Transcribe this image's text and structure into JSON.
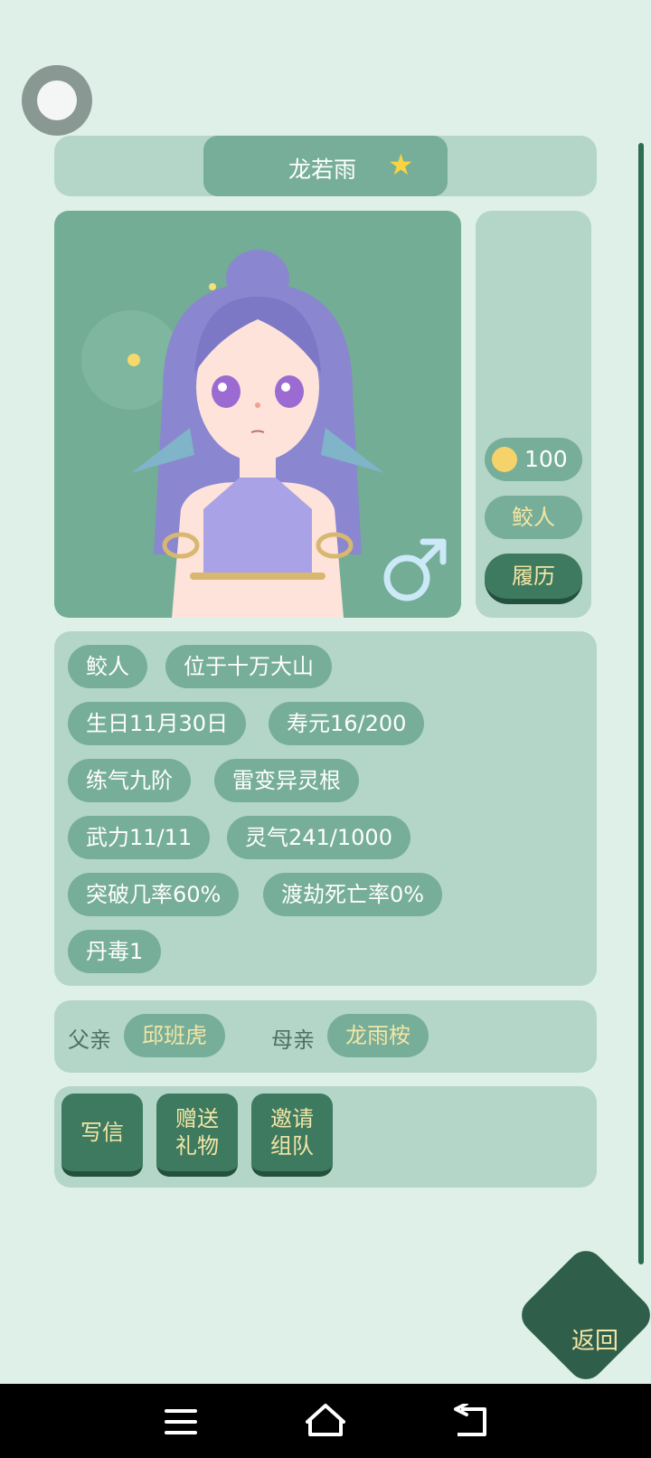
{
  "header": {
    "name": "龙若雨"
  },
  "side_panel": {
    "mood_value": "100",
    "race_label": "鲛人",
    "resume_button": "履历"
  },
  "tags": [
    "鲛人",
    "位于十万大山",
    "生日11月30日",
    "寿元16/200",
    "练气九阶",
    "雷变异灵根",
    "武力11/11",
    "灵气241/1000",
    "突破几率60%",
    "渡劫死亡率0%",
    "丹毒1"
  ],
  "family": {
    "father_label": "父亲",
    "father_name": "邱班虎",
    "mother_label": "母亲",
    "mother_name": "龙雨桉"
  },
  "actions": {
    "write_letter": "写信",
    "send_gift": "赠送\n礼物",
    "invite_team": "邀请\n组队"
  },
  "back_button": "返回",
  "colors": {
    "background": "#dff0e8",
    "panel": "#b3d6c8",
    "pill": "#77ae99",
    "button": "#3e7a60",
    "gold_text": "#f3e6a4"
  }
}
